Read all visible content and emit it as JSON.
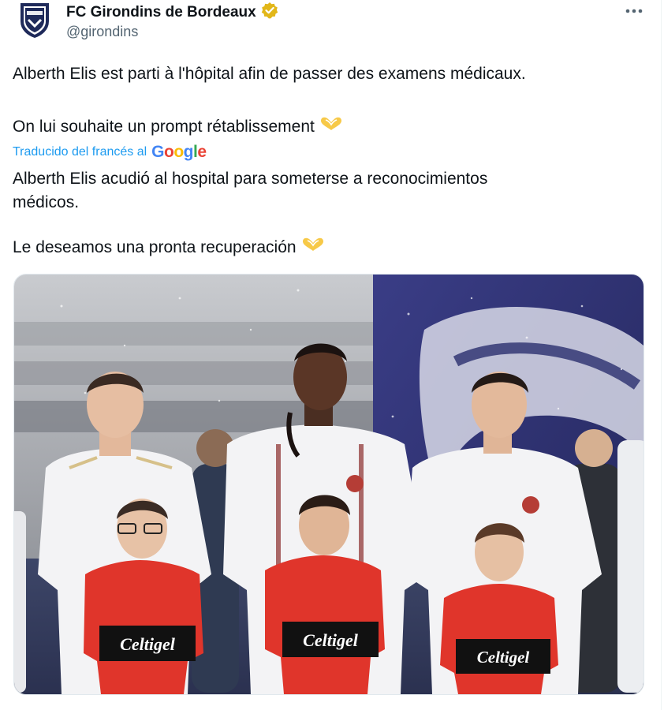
{
  "tweet": {
    "author": {
      "display_name": "FC Girondins de Bordeaux",
      "handle": "@girondins",
      "verified": true,
      "verified_badge_color": "#e2b719",
      "avatar_icon": "girondins-crest-icon",
      "avatar_crest_text": "GIRONDINS BORDEAUX"
    },
    "more_icon": "more-horizontal-icon",
    "original_text": {
      "line1": "Alberth Elis est parti à l'hôpital afin de passer des examens médicaux.",
      "line2": "On lui souhaite un prompt rétablissement"
    },
    "translation": {
      "label": "Traducido del francés al",
      "provider": "Google",
      "provider_letter_colors": [
        "#4285f4",
        "#ea4335",
        "#fbbc05",
        "#4285f4",
        "#34a853",
        "#ea4335"
      ],
      "line1": "Alberth Elis acudió al hospital para someterse a reconocimientos",
      "line2": "médicos.",
      "line3": "Le deseamos una pronta recuperación"
    },
    "emoji": "heart-hands-emoji",
    "emoji_color": "#f7c948",
    "media": {
      "description_icon": "photo",
      "shirt_sponsor": "Celtigel"
    }
  },
  "colors": {
    "link": "#1d9bf0",
    "secondary_text": "#536471",
    "kit_red": "#e0352b",
    "kit_black": "#111111",
    "jacket_white": "#f3f3f5",
    "banner_navy": "#2b2e6e"
  }
}
